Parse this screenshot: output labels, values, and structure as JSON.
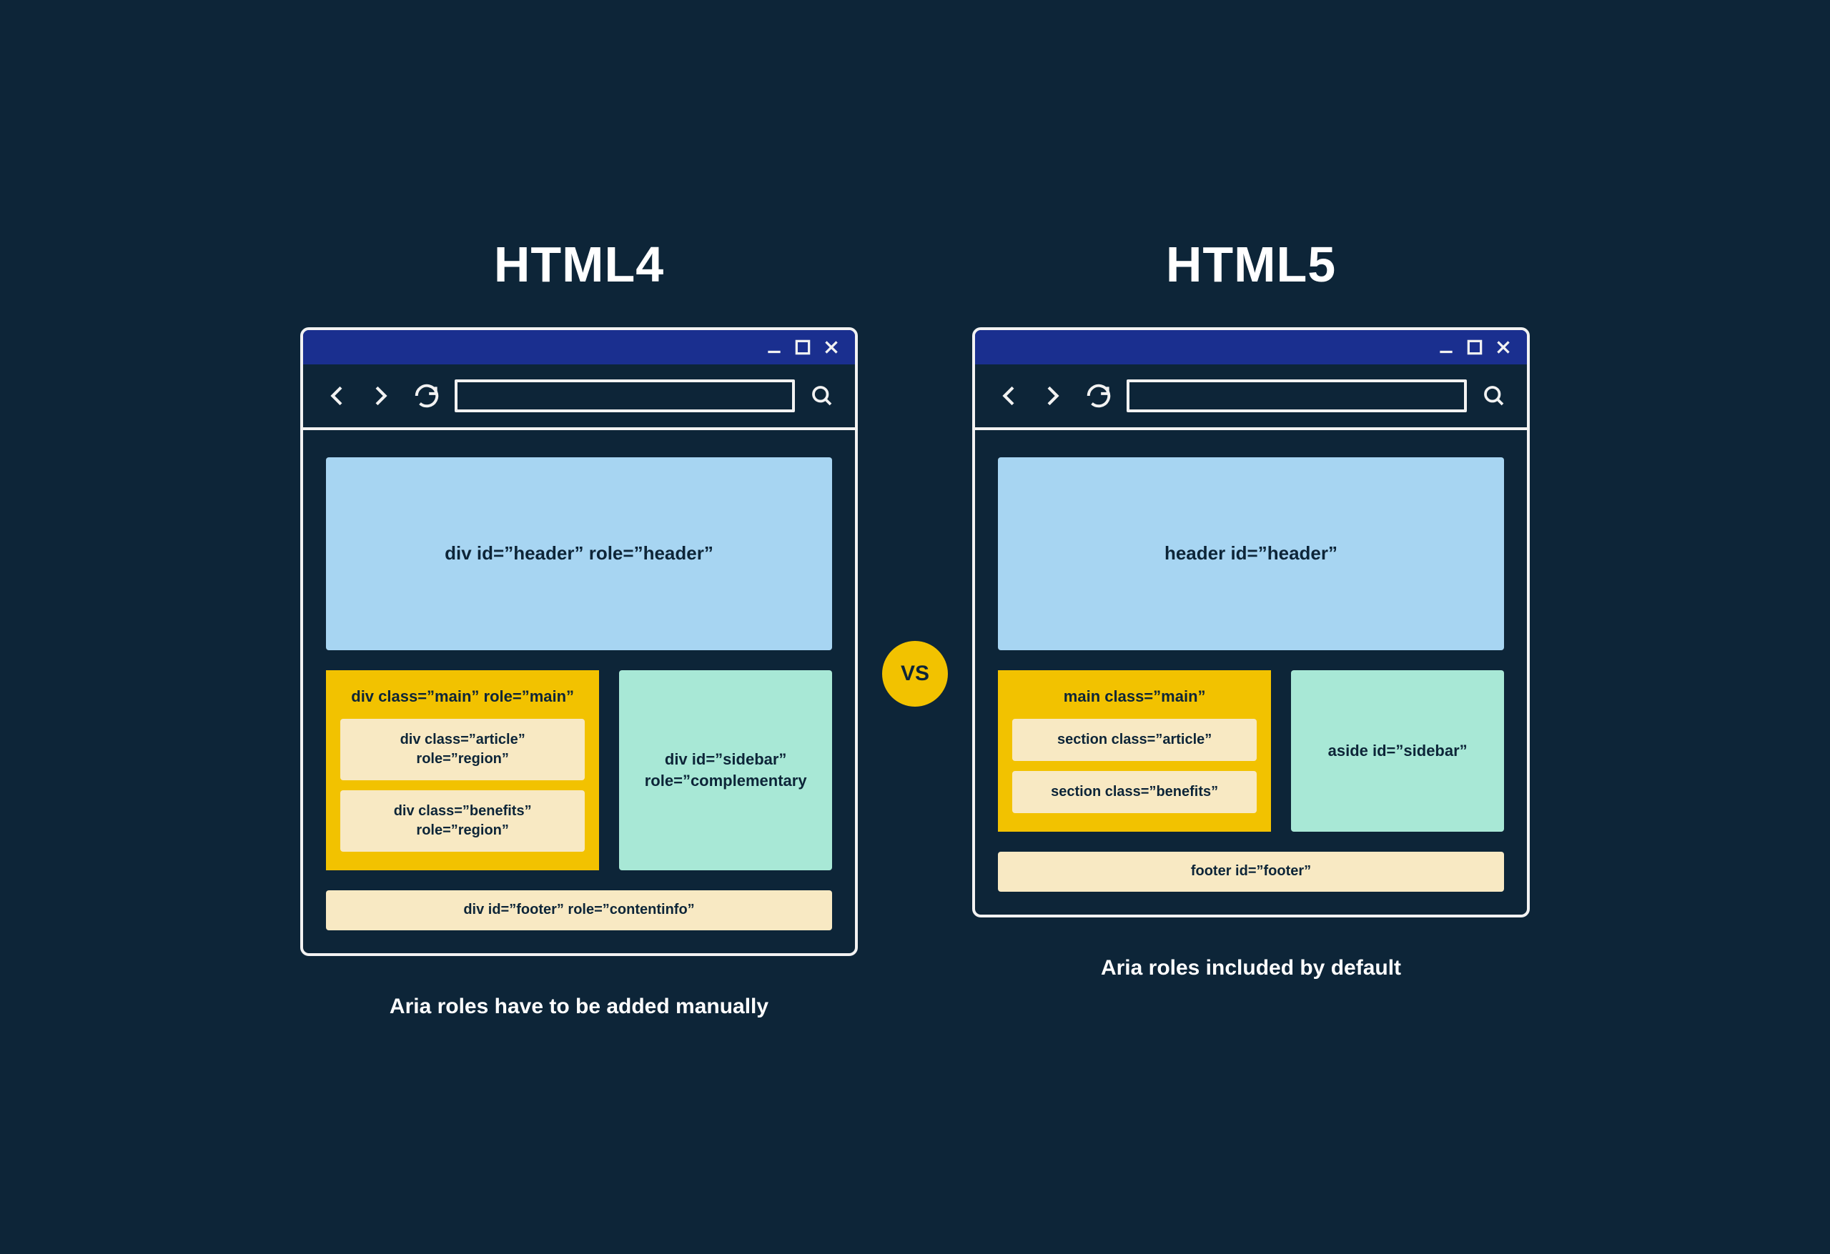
{
  "vs_label": "VS",
  "left": {
    "title": "HTML4",
    "caption": "Aria roles have to be added manually",
    "header_text": "div id=”header” role=”header”",
    "main_text": "div class=”main” role=”main”",
    "article_text": "div class=”article”\nrole=”region”",
    "benefits_text": "div class=”benefits”\nrole=”region”",
    "sidebar_text": "div id=”sidebar”\nrole=”complementary",
    "footer_text": "div id=”footer” role=”contentinfo”"
  },
  "right": {
    "title": "HTML5",
    "caption": "Aria roles included by default",
    "header_text": "header id=”header”",
    "main_text": "main class=”main”",
    "article_text": "section class=”article”",
    "benefits_text": "section class=”benefits”",
    "sidebar_text": "aside id=”sidebar”",
    "footer_text": "footer id=”footer”"
  },
  "colors": {
    "background": "#0d2538",
    "titlebar": "#1a2f8f",
    "border": "#f2f2f2",
    "header_block": "#a7d5f2",
    "main_block": "#f2c200",
    "sub_block": "#f8e9c3",
    "sidebar_block": "#a8e8d6",
    "text": "#0d2538"
  },
  "icons": {
    "minimize": "minimize-icon",
    "maximize": "maximize-icon",
    "close": "close-icon",
    "back": "chevron-left-icon",
    "forward": "chevron-right-icon",
    "reload": "reload-icon",
    "search": "search-icon"
  }
}
